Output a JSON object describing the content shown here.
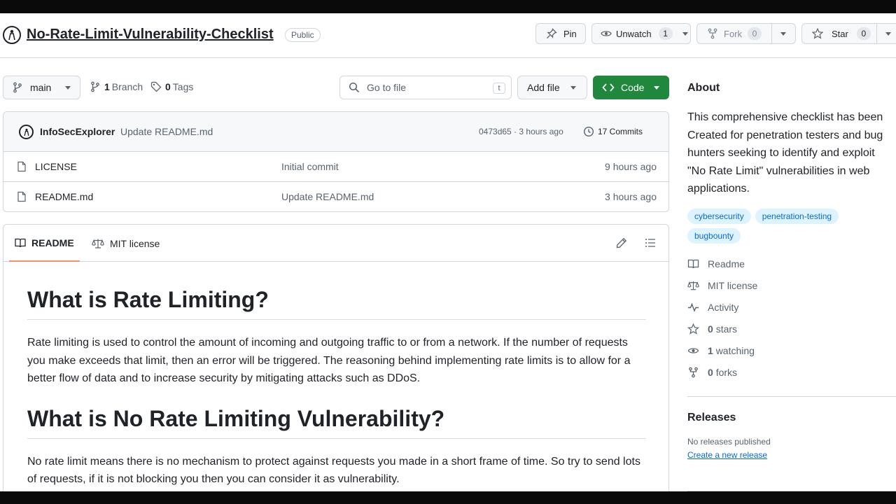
{
  "repo": {
    "name": "No-Rate-Limit-Vulnerability-Checklist",
    "visibility": "Public",
    "pin_label": "Pin",
    "watch_label": "Unwatch",
    "watch_count": "1",
    "fork_label": "Fork",
    "fork_count": "0",
    "star_label": "Star",
    "star_count": "0"
  },
  "branchbar": {
    "branch": "main",
    "branch_count": "1",
    "branch_label": "Branch",
    "tag_count": "0",
    "tag_label": "Tags",
    "goto_placeholder": "Go to file",
    "goto_shortcut": "t",
    "add_file_label": "Add file",
    "code_label": "Code"
  },
  "commit": {
    "author": "InfoSecExplorer",
    "message": "Update README.md",
    "hash_time": "0473d65 · 3 hours ago",
    "commits_label": "17 Commits"
  },
  "files": [
    {
      "name": "LICENSE",
      "message": "Initial commit",
      "time": "9 hours ago"
    },
    {
      "name": "README.md",
      "message": "Update README.md",
      "time": "3 hours ago"
    }
  ],
  "readme": {
    "tab_readme": "README",
    "tab_license": "MIT license",
    "h1_1": "What is Rate Limiting?",
    "p_1": "Rate limiting is used to control the amount of incoming and outgoing traffic to or from a network. If the number of requests you make exceeds that limit, then an error will be triggered. The reasoning behind implementing rate limits is to allow for a better flow of data and to increase security by mitigating attacks such as DDoS.",
    "h1_2": "What is No Rate Limiting Vulnerability?",
    "p_2": "No rate limit means there is no mechanism to protect against requests you made in a short frame of time. So try to send lots of requests, if it is not blocking you then you can consider it as vulnerability."
  },
  "about": {
    "title": "About",
    "description": "This comprehensive checklist has been Created for penetration testers and bug hunters seeking to identify and exploit \"No Rate Limit\" vulnerabilities in web applications.",
    "topics": [
      "cybersecurity",
      "penetration-testing",
      "bugbounty"
    ],
    "readme_link": "Readme",
    "license_link": "MIT license",
    "activity_link": "Activity",
    "stars_count": "0",
    "stars_label": "stars",
    "watching_count": "1",
    "watching_label": "watching",
    "forks_count": "0",
    "forks_label": "forks"
  },
  "releases": {
    "title": "Releases",
    "empty_text": "No releases published",
    "create_link": "Create a new release"
  },
  "colors": {
    "accent": "#0969da",
    "code_button": "#1f883d",
    "tab_underline": "#fd8c73",
    "topic_bg": "#ddf4ff"
  }
}
